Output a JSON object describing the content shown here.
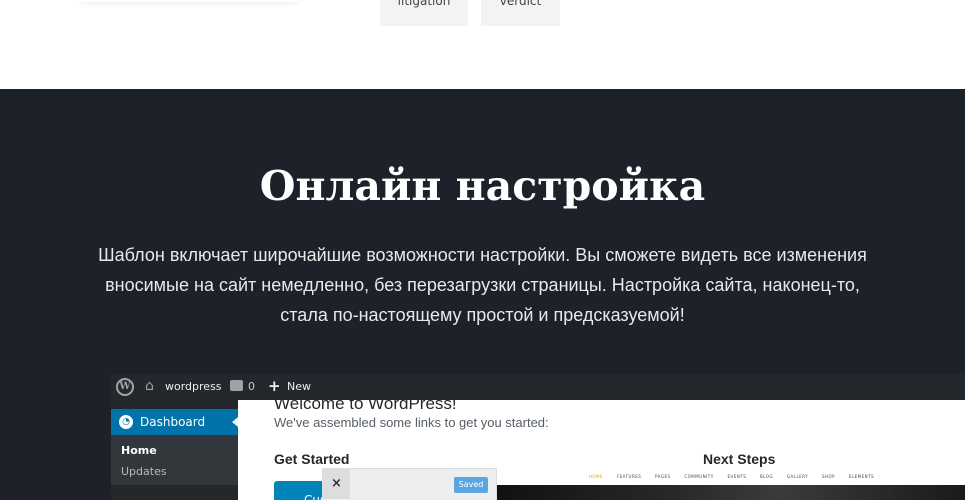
{
  "tags": [
    "litigation",
    "verdict"
  ],
  "section": {
    "title": "Онлайн настройка",
    "description": "Шаблон включает широчайшие возможности настройки. Вы сможете видеть все изменения вносимые на сайт немедленно, без перезагрузки страницы. Настройка сайта, наконец-то, стала по-настоящему простой и предсказуемой!"
  },
  "screenshot": {
    "adminbar": {
      "site_name": "wordpress",
      "comments_count": "0",
      "new_label": "New"
    },
    "sidebar": {
      "dashboard_label": "Dashboard",
      "home_label": "Home",
      "updates_label": "Updates"
    },
    "main": {
      "welcome_title": "Welcome to WordPress!",
      "welcome_sub": "We've assembled some links to get you started:",
      "get_started": "Get Started",
      "next_steps": "Next Steps",
      "button_label": "Cus"
    },
    "popup": {
      "close": "×",
      "saved": "Saved"
    },
    "preview_nav": [
      "HOME",
      "FEATURES",
      "PAGES",
      "COMMUNITY",
      "EVENTS",
      "BLOG",
      "GALLERY",
      "SHOP",
      "ELEMENTS"
    ]
  },
  "colors": {
    "dark_bg": "#1d2129",
    "wp_blue": "#0073aa",
    "admin_bar": "#23282d"
  }
}
